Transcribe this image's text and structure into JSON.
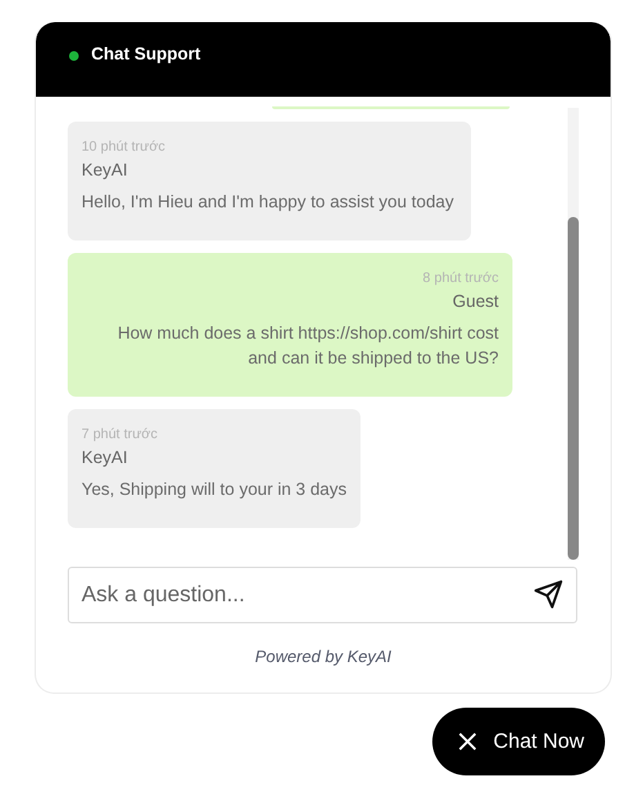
{
  "header": {
    "title": "Chat Support",
    "online": true
  },
  "messages": [
    {
      "kind": "bot",
      "time": "10 phút trước",
      "author": "KeyAI",
      "text": "Hello, I'm Hieu and I'm happy to assist you today"
    },
    {
      "kind": "guest",
      "time": "8 phút trước",
      "author": "Guest",
      "text": "How much does a shirt https://shop.com/shirt cost and can it be shipped to the US?"
    },
    {
      "kind": "bot",
      "time": "7 phút trước",
      "author": "KeyAI",
      "text": "Yes, Shipping will to your in 3 days"
    }
  ],
  "input": {
    "placeholder": "Ask a question..."
  },
  "footer": "Powered by KeyAI",
  "launcher": {
    "label": "Chat Now"
  }
}
